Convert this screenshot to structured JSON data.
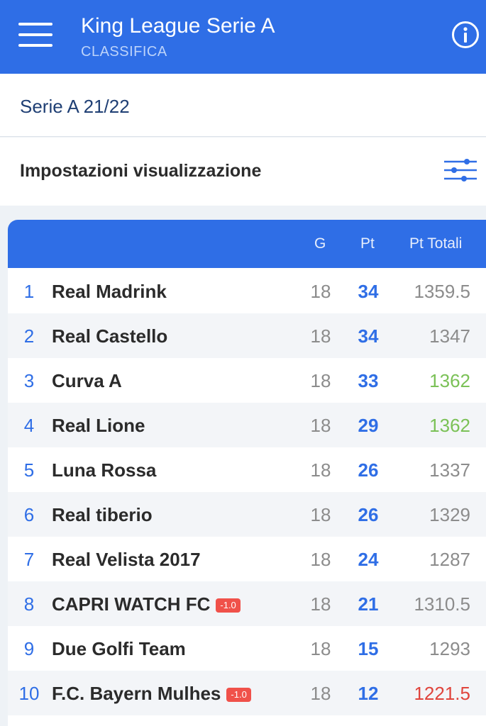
{
  "header": {
    "title": "King League Serie A",
    "subtitle": "CLASSIFICA"
  },
  "season": {
    "label": "Serie A 21/22"
  },
  "settings": {
    "label": "Impostazioni visualizzazione"
  },
  "icons": {
    "menu": "hamburger-menu-icon",
    "info": "info-icon",
    "settings": "sliders-icon"
  },
  "colors": {
    "primary": "#2f6ee6",
    "highlight_green": "#7bc157",
    "highlight_red": "#e0443c",
    "penalty_badge": "#f0514a"
  },
  "table": {
    "columns": {
      "g": "G",
      "pt": "Pt",
      "tot": "Pt Totali"
    },
    "rows": [
      {
        "pos": "1",
        "team": "Real Madrink",
        "penalty": "",
        "g": "18",
        "pt": "34",
        "tot": "1359.5",
        "tot_color": "#8c8c8c"
      },
      {
        "pos": "2",
        "team": "Real Castello",
        "penalty": "",
        "g": "18",
        "pt": "34",
        "tot": "1347",
        "tot_color": "#8c8c8c"
      },
      {
        "pos": "3",
        "team": "Curva A",
        "penalty": "",
        "g": "18",
        "pt": "33",
        "tot": "1362",
        "tot_color": "#7bc157"
      },
      {
        "pos": "4",
        "team": "Real Lione",
        "penalty": "",
        "g": "18",
        "pt": "29",
        "tot": "1362",
        "tot_color": "#7bc157"
      },
      {
        "pos": "5",
        "team": "Luna Rossa",
        "penalty": "",
        "g": "18",
        "pt": "26",
        "tot": "1337",
        "tot_color": "#8c8c8c"
      },
      {
        "pos": "6",
        "team": "Real tiberio",
        "penalty": "",
        "g": "18",
        "pt": "26",
        "tot": "1329",
        "tot_color": "#8c8c8c"
      },
      {
        "pos": "7",
        "team": "Real Velista 2017",
        "penalty": "",
        "g": "18",
        "pt": "24",
        "tot": "1287",
        "tot_color": "#8c8c8c"
      },
      {
        "pos": "8",
        "team": "CAPRI WATCH FC",
        "penalty": "-1.0",
        "g": "18",
        "pt": "21",
        "tot": "1310.5",
        "tot_color": "#8c8c8c"
      },
      {
        "pos": "9",
        "team": "Due Golfi Team",
        "penalty": "",
        "g": "18",
        "pt": "15",
        "tot": "1293",
        "tot_color": "#8c8c8c"
      },
      {
        "pos": "10",
        "team": "F.C. Bayern Mulhes",
        "penalty": "-1.0",
        "g": "18",
        "pt": "12",
        "tot": "1221.5",
        "tot_color": "#e0443c"
      }
    ]
  }
}
